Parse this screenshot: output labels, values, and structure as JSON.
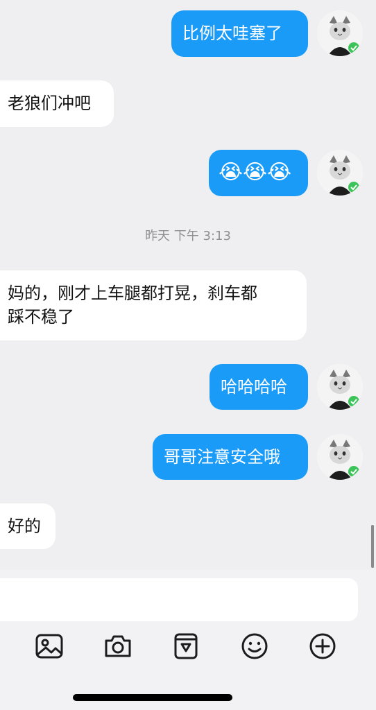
{
  "messages": [
    {
      "side": "out",
      "text": "比例太哇塞了"
    },
    {
      "side": "in",
      "text": "老狼们冲吧"
    },
    {
      "side": "out",
      "text": "😭😭😭",
      "emoji_name": "loudly-crying-face"
    },
    {
      "side": "in",
      "line1": "妈的，刚才上车腿都打晃，刹车都",
      "line2": "踩不稳了"
    },
    {
      "side": "out",
      "text": "哈哈哈哈"
    },
    {
      "side": "out",
      "text": "哥哥注意安全哦"
    },
    {
      "side": "in",
      "text": "好的"
    }
  ],
  "timestamp": "昨天 下午 3:13",
  "toolbar": {
    "icons": [
      "image-icon",
      "camera-icon",
      "sticker-icon",
      "emoji-icon",
      "plus-icon"
    ]
  },
  "colors": {
    "outgoing_bubble": "#1a9bf8",
    "incoming_bubble": "#ffffff",
    "background": "#efeff1",
    "online_badge": "#3cc45a"
  }
}
